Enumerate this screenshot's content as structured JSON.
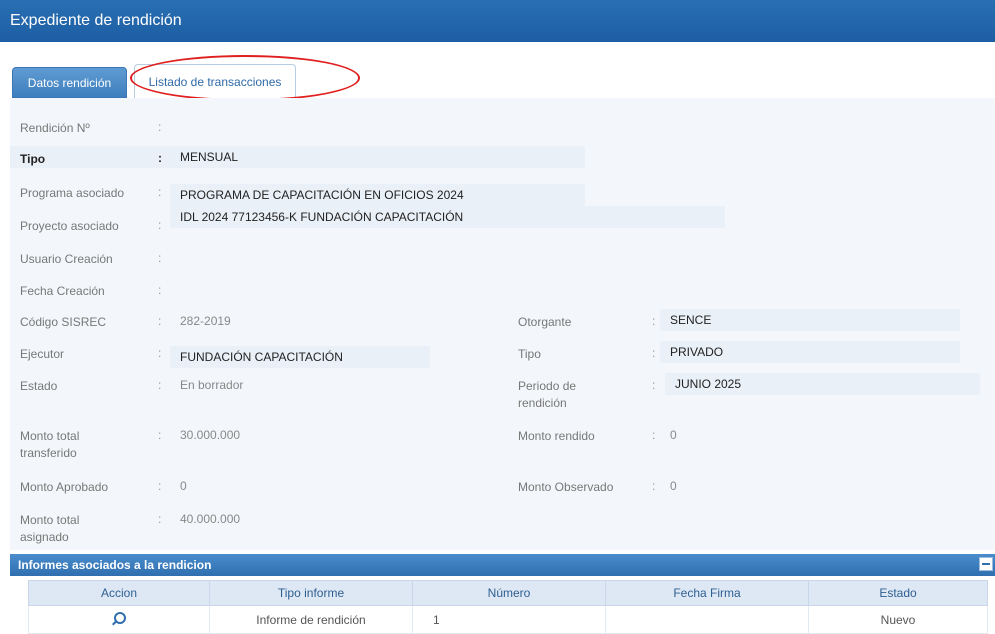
{
  "window": {
    "title": "Expediente de rendición"
  },
  "tabs": [
    {
      "label": "Datos rendición"
    },
    {
      "label": "Listado de transacciones"
    }
  ],
  "form": {
    "rendicion_no": {
      "label": "Rendición Nº",
      "value": ""
    },
    "tipo": {
      "label": "Tipo",
      "value": "MENSUAL"
    },
    "programa": {
      "label": "Programa asociado",
      "value": "PROGRAMA DE CAPACITACIÓN EN OFICIOS 2024"
    },
    "proyecto": {
      "label": "Proyecto asociado",
      "value": "IDL 2024 77123456-K FUNDACIÓN CAPACITACIÓN"
    },
    "usuario": {
      "label": "Usuario Creación",
      "value": ""
    },
    "fecha": {
      "label": "Fecha Creación",
      "value": ""
    },
    "codigo": {
      "label": "Código SISREC",
      "value": "282-2019"
    },
    "ejecutor": {
      "label": "Ejecutor",
      "value": "FUNDACIÓN CAPACITACIÓN"
    },
    "estado": {
      "label": "Estado",
      "value": "En borrador"
    },
    "monto_transferido": {
      "label_line1": "Monto total",
      "label_line2": "transferido",
      "value": "30.000.000"
    },
    "monto_aprobado": {
      "label": "Monto Aprobado",
      "value": "0"
    },
    "monto_asignado": {
      "label_line1": "Monto total",
      "label_line2": "asignado",
      "value": "40.000.000"
    },
    "otorgante": {
      "label": "Otorgante",
      "value": "SENCE"
    },
    "tipo2": {
      "label": "Tipo",
      "value": "PRIVADO"
    },
    "periodo": {
      "label_line1": "Periodo de",
      "label_line2": "rendición",
      "value": "JUNIO 2025"
    },
    "monto_rendido": {
      "label": "Monto rendido",
      "value": "0"
    },
    "monto_observado": {
      "label": "Monto Observado",
      "value": "0"
    },
    "separator": ":"
  },
  "informes": {
    "title": "Informes asociados a la rendicion",
    "columns": [
      "Accion",
      "Tipo informe",
      "Número",
      "Fecha Firma",
      "Estado"
    ],
    "rows": [
      {
        "accion_icon": "search-icon",
        "tipo": "Informe de rendición",
        "numero": "1",
        "fecha": "",
        "estado": "Nuevo"
      }
    ]
  },
  "colors": {
    "header_blue": "#1d5ea3",
    "tab_active": "#3f7fbf",
    "annotation_red": "#e02020",
    "panel_bg": "#f3f7fb"
  }
}
